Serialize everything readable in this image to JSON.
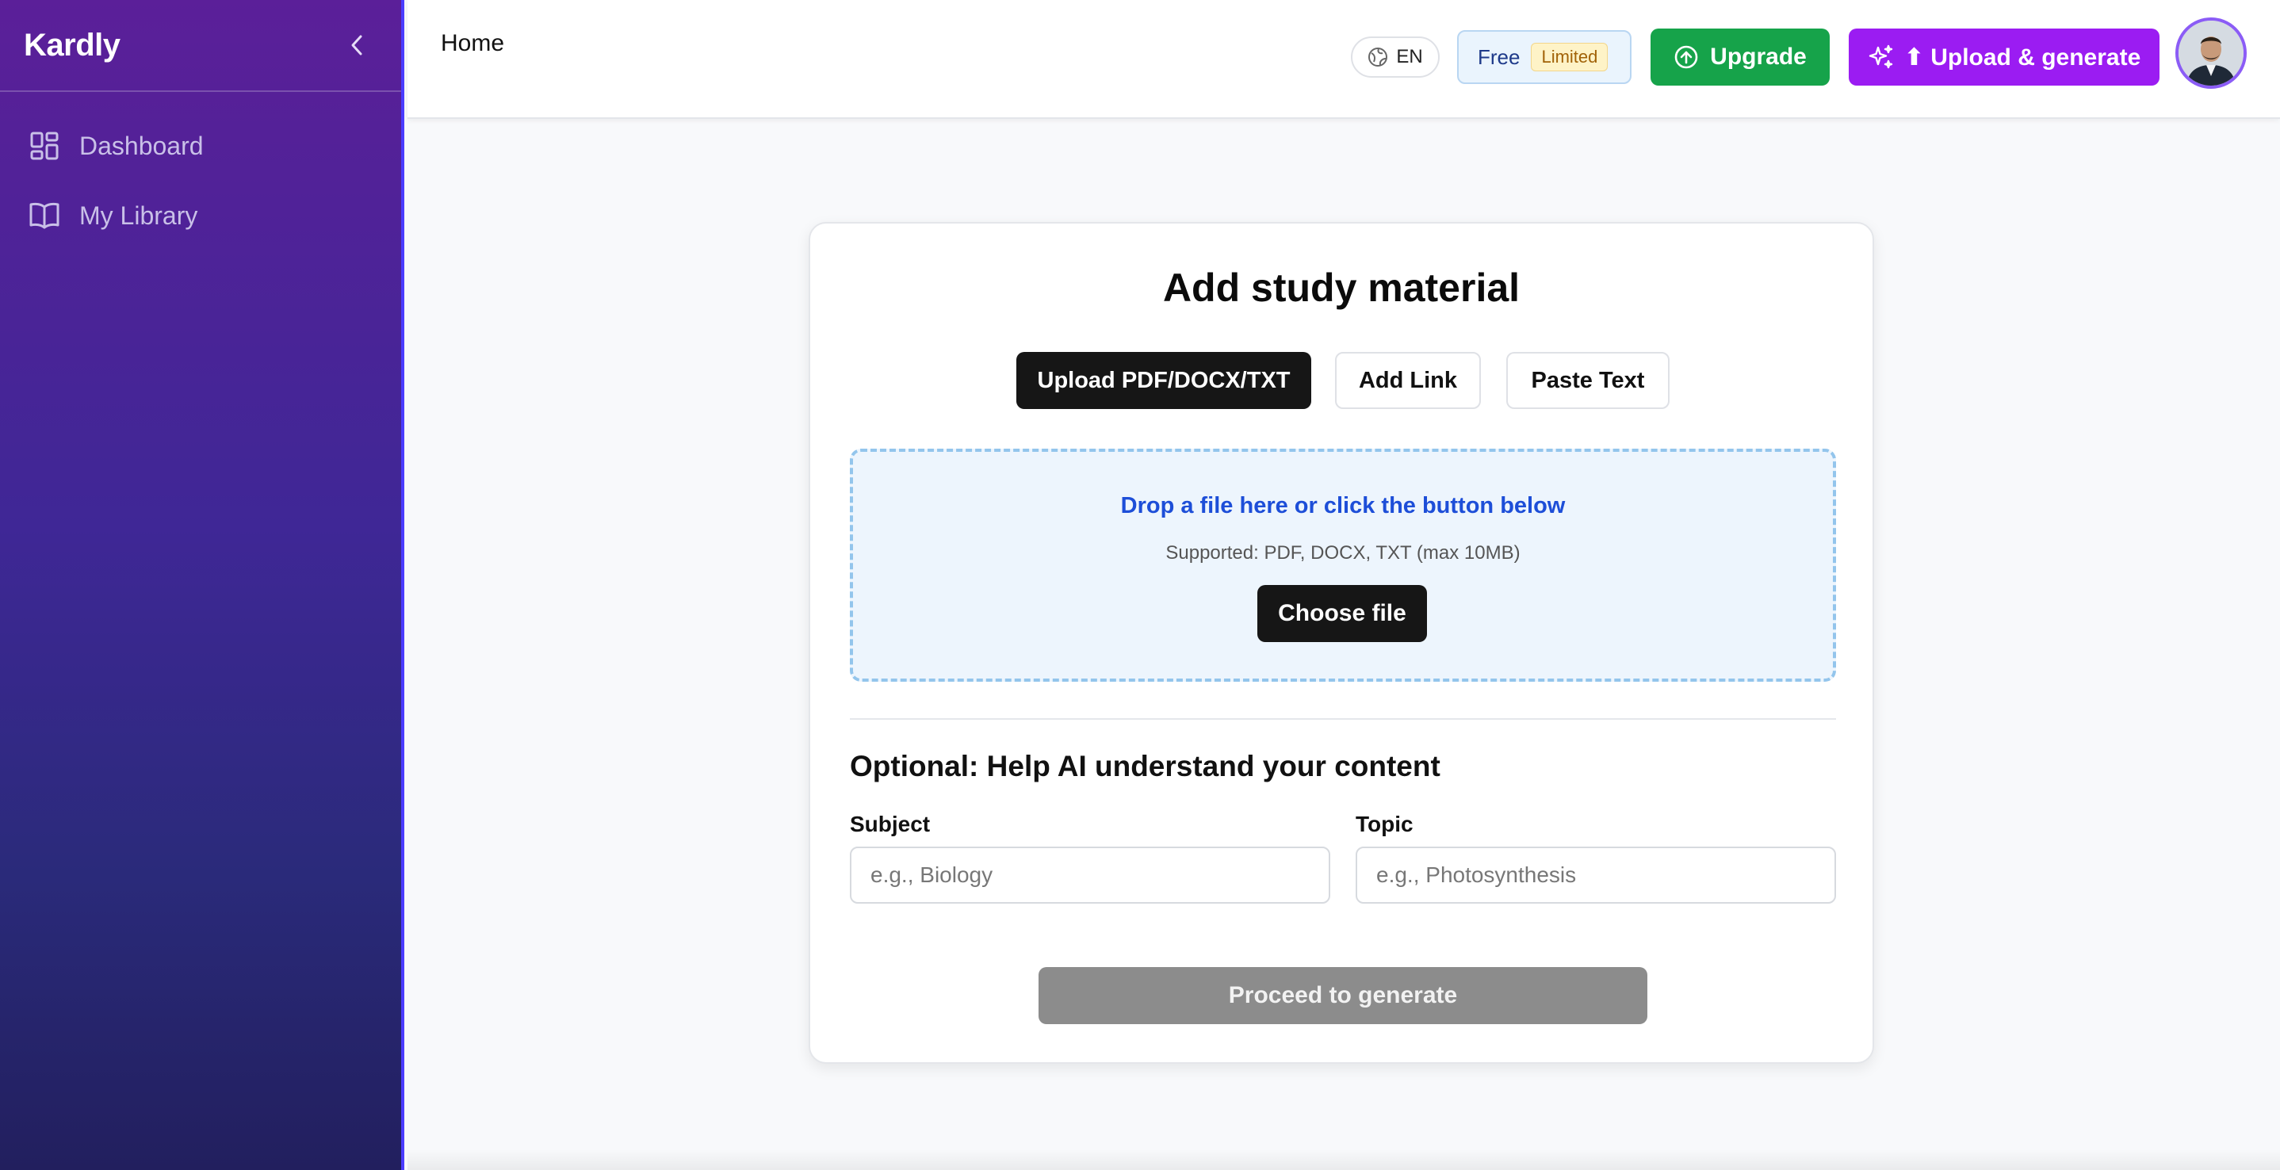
{
  "sidebar": {
    "brand": "Kardly",
    "items": [
      {
        "label": "Dashboard",
        "icon": "dashboard-icon"
      },
      {
        "label": "My Library",
        "icon": "book-icon"
      }
    ]
  },
  "header": {
    "title": "Home",
    "language": "EN",
    "plan": {
      "name": "Free",
      "badge": "Limited"
    },
    "upgrade_label": "Upgrade",
    "upload_generate_label": "⬆ Upload & generate"
  },
  "card": {
    "title": "Add study material",
    "tabs": [
      {
        "label": "Upload PDF/DOCX/TXT",
        "active": true
      },
      {
        "label": "Add Link",
        "active": false
      },
      {
        "label": "Paste Text",
        "active": false
      }
    ],
    "dropzone": {
      "primary": "Drop a file here or click the button below",
      "secondary": "Supported: PDF, DOCX, TXT (max 10MB)",
      "choose_label": "Choose file"
    },
    "optional": {
      "heading": "Optional: Help AI understand your content",
      "subject_label": "Subject",
      "subject_placeholder": "e.g., Biology",
      "topic_label": "Topic",
      "topic_placeholder": "e.g., Photosynthesis"
    },
    "proceed_label": "Proceed to generate"
  },
  "colors": {
    "sidebar_top": "#5b1f99",
    "sidebar_bottom": "#221f5e",
    "upgrade": "#16a34a",
    "upload_generate": "#9b1cf2",
    "dropzone_text": "#1d4ed8",
    "proceed_disabled": "#8c8c8c"
  }
}
